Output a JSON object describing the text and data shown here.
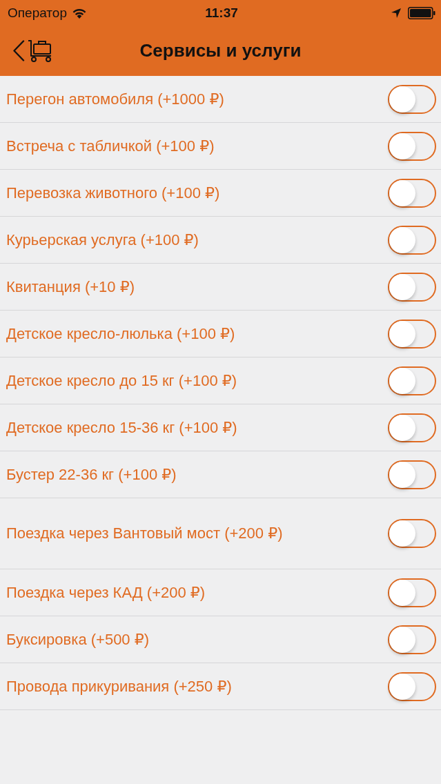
{
  "status_bar": {
    "carrier": "Оператор",
    "time": "11:37"
  },
  "nav_bar": {
    "title": "Сервисы и услуги"
  },
  "services": [
    {
      "label": "Перегон автомобиля (+1000 ₽)",
      "on": false
    },
    {
      "label": "Встреча с табличкой (+100 ₽)",
      "on": false
    },
    {
      "label": "Перевозка животного (+100 ₽)",
      "on": false
    },
    {
      "label": "Курьерская услуга (+100 ₽)",
      "on": false
    },
    {
      "label": "Квитанция (+10 ₽)",
      "on": false
    },
    {
      "label": "Детское кресло-люлька (+100 ₽)",
      "on": false
    },
    {
      "label": "Детское кресло до 15 кг (+100 ₽)",
      "on": false
    },
    {
      "label": "Детское кресло 15-36 кг (+100 ₽)",
      "on": false
    },
    {
      "label": "Бустер 22-36 кг (+100 ₽)",
      "on": false
    },
    {
      "label": "Поездка через Вантовый мост (+200 ₽)",
      "on": false
    },
    {
      "label": "Поездка через КАД (+200 ₽)",
      "on": false
    },
    {
      "label": "Буксировка (+500 ₽)",
      "on": false
    },
    {
      "label": "Провода прикуривания (+250 ₽)",
      "on": false
    }
  ]
}
